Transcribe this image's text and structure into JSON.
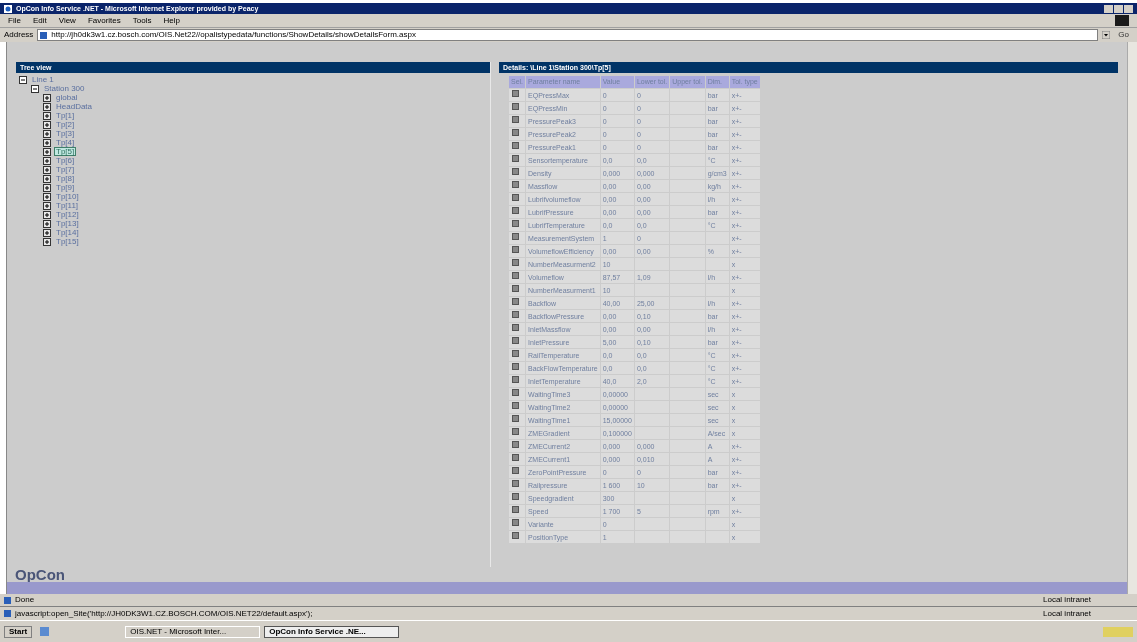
{
  "window": {
    "title": "OpCon Info Service .NET - Microsoft Internet Explorer provided by Peacy"
  },
  "menu": [
    {
      "label": "File"
    },
    {
      "label": "Edit"
    },
    {
      "label": "View"
    },
    {
      "label": "Favorites"
    },
    {
      "label": "Tools"
    },
    {
      "label": "Help"
    }
  ],
  "address_bar": {
    "label": "Address",
    "value": "http://jh0dk3w1.cz.bosch.com/OIS.Net22//opalistypedata/functions/ShowDetails/showDetailsForm.aspx",
    "go": "Go"
  },
  "tree_panel": {
    "title": "Tree view",
    "nodes": [
      {
        "label": "Line 1",
        "expanded": true,
        "selected": false,
        "children": [
          {
            "label": "Station 300",
            "expanded": true,
            "selected": false,
            "children": [
              {
                "label": "global",
                "expanded": false,
                "selected": false
              },
              {
                "label": "HeadData",
                "expanded": false,
                "selected": false
              },
              {
                "label": "Tp[1]",
                "expanded": false,
                "selected": false
              },
              {
                "label": "Tp[2]",
                "expanded": false,
                "selected": false
              },
              {
                "label": "Tp[3]",
                "expanded": false,
                "selected": false
              },
              {
                "label": "Tp[4]",
                "expanded": false,
                "selected": false
              },
              {
                "label": "Tp[5]",
                "expanded": false,
                "selected": true
              },
              {
                "label": "Tp[6]",
                "expanded": false,
                "selected": false
              },
              {
                "label": "Tp[7]",
                "expanded": false,
                "selected": false
              },
              {
                "label": "Tp[8]",
                "expanded": false,
                "selected": false
              },
              {
                "label": "Tp[9]",
                "expanded": false,
                "selected": false
              },
              {
                "label": "Tp[10]",
                "expanded": false,
                "selected": false
              },
              {
                "label": "Tp[11]",
                "expanded": false,
                "selected": false
              },
              {
                "label": "Tp[12]",
                "expanded": false,
                "selected": false
              },
              {
                "label": "Tp[13]",
                "expanded": false,
                "selected": false
              },
              {
                "label": "Tp[14]",
                "expanded": false,
                "selected": false
              },
              {
                "label": "Tp[15]",
                "expanded": false,
                "selected": false
              }
            ]
          }
        ]
      }
    ]
  },
  "details_panel": {
    "title": "Details: \\Line 1\\Station 300\\Tp[5]",
    "table": {
      "columns": [
        "Sel.",
        "Parameter name",
        "Value",
        "Lower tol.",
        "Upper tol.",
        "Dim.",
        "Tol. type"
      ],
      "rows": [
        {
          "checked": true,
          "name": "EQPressMax",
          "value": "0",
          "lower": "0",
          "dim": "bar",
          "tol": "x+-"
        },
        {
          "checked": true,
          "name": "EQPressMin",
          "value": "0",
          "lower": "0",
          "dim": "bar",
          "tol": "x+-"
        },
        {
          "checked": true,
          "name": "PressurePeak3",
          "value": "0",
          "lower": "0",
          "dim": "bar",
          "tol": "x+-"
        },
        {
          "checked": true,
          "name": "PressurePeak2",
          "value": "0",
          "lower": "0",
          "dim": "bar",
          "tol": "x+-"
        },
        {
          "checked": true,
          "name": "PressurePeak1",
          "value": "0",
          "lower": "0",
          "dim": "bar",
          "tol": "x+-"
        },
        {
          "checked": true,
          "name": "Sensortemperature",
          "value": "0,0",
          "lower": "0,0",
          "dim": "°C",
          "tol": "x+-"
        },
        {
          "checked": true,
          "name": "Density",
          "value": "0,000",
          "lower": "0,000",
          "dim": "g/cm3",
          "tol": "x+-"
        },
        {
          "checked": true,
          "name": "Massflow",
          "value": "0,00",
          "lower": "0,00",
          "dim": "kg/h",
          "tol": "x+-"
        },
        {
          "checked": true,
          "name": "Lubrifvolumeflow",
          "value": "0,00",
          "lower": "0,00",
          "dim": "l/h",
          "tol": "x+-"
        },
        {
          "checked": true,
          "name": "LubrifPressure",
          "value": "0,00",
          "lower": "0,00",
          "dim": "bar",
          "tol": "x+-"
        },
        {
          "checked": true,
          "name": "LubrifTemperature",
          "value": "0,0",
          "lower": "0,0",
          "dim": "°C",
          "tol": "x+-"
        },
        {
          "checked": true,
          "name": "MeasurementSystem",
          "value": "1",
          "lower": "0",
          "tol": "x+-"
        },
        {
          "checked": true,
          "name": "VolumeflowEfficiency",
          "value": "0,00",
          "lower": "0,00",
          "dim": "%",
          "tol": "x+-"
        },
        {
          "checked": true,
          "name": "NumberMeasurment2",
          "value": "10",
          "tol": "x"
        },
        {
          "checked": true,
          "name": "Volumeflow",
          "value": "87,57",
          "lower": "1,09",
          "dim": "l/h",
          "tol": "x+-"
        },
        {
          "checked": true,
          "name": "NumberMeasurment1",
          "value": "10",
          "tol": "x"
        },
        {
          "checked": true,
          "name": "Backflow",
          "value": "40,00",
          "lower": "25,00",
          "dim": "l/h",
          "tol": "x+-"
        },
        {
          "checked": true,
          "name": "BackflowPressure",
          "value": "0,00",
          "lower": "0,10",
          "dim": "bar",
          "tol": "x+-"
        },
        {
          "checked": true,
          "name": "InletMassflow",
          "value": "0,00",
          "lower": "0,00",
          "dim": "l/h",
          "tol": "x+-"
        },
        {
          "checked": true,
          "name": "InletPressure",
          "value": "5,00",
          "lower": "0,10",
          "dim": "bar",
          "tol": "x+-"
        },
        {
          "checked": true,
          "name": "RailTemperature",
          "value": "0,0",
          "lower": "0,0",
          "dim": "°C",
          "tol": "x+-"
        },
        {
          "checked": true,
          "name": "BackFlowTemperature",
          "value": "0,0",
          "lower": "0,0",
          "dim": "°C",
          "tol": "x+-"
        },
        {
          "checked": true,
          "name": "InletTemperature",
          "value": "40,0",
          "lower": "2,0",
          "dim": "°C",
          "tol": "x+-"
        },
        {
          "checked": true,
          "name": "WaitingTime3",
          "value": "0,00000",
          "dim": "sec",
          "tol": "x"
        },
        {
          "checked": true,
          "name": "WaitingTime2",
          "value": "0,00000",
          "dim": "sec",
          "tol": "x"
        },
        {
          "checked": true,
          "name": "WaitingTime1",
          "value": "15,00000",
          "dim": "sec",
          "tol": "x"
        },
        {
          "checked": true,
          "name": "ZMEGradient",
          "value": "0,100000",
          "dim": "A/sec",
          "tol": "x"
        },
        {
          "checked": true,
          "name": "ZMECurrent2",
          "value": "0,000",
          "lower": "0,000",
          "dim": "A",
          "tol": "x+-"
        },
        {
          "checked": true,
          "name": "ZMECurrent1",
          "value": "0,000",
          "lower": "0,010",
          "dim": "A",
          "tol": "x+-"
        },
        {
          "checked": true,
          "name": "ZeroPointPressure",
          "value": "0",
          "lower": "0",
          "dim": "bar",
          "tol": "x+-"
        },
        {
          "checked": true,
          "name": "Railpressure",
          "value": "1 600",
          "lower": "10",
          "dim": "bar",
          "tol": "x+-"
        },
        {
          "checked": true,
          "name": "Speedgradient",
          "value": "300",
          "tol": "x"
        },
        {
          "checked": true,
          "name": "Speed",
          "value": "1 700",
          "lower": "5",
          "dim": "rpm",
          "tol": "x+-"
        },
        {
          "checked": true,
          "name": "Variante",
          "value": "0",
          "tol": "x"
        },
        {
          "checked": true,
          "name": "PositionType",
          "value": "1",
          "tol": "x"
        }
      ]
    }
  },
  "footer_logo": "OpCon",
  "status_bar": {
    "text": "Done",
    "zone": "Local intranet"
  },
  "status_bar_2": {
    "text": "javascript:open_Site('http://JH0DK3W1.CZ.BOSCH.COM/OIS.NET22/default.aspx');",
    "zone": "Local intranet"
  },
  "taskbar": {
    "start": "Start",
    "tasks": [
      {
        "label": "OIS.NET - Microsoft Inter...",
        "selected": false
      },
      {
        "label": "OpCon Info Service .NE...",
        "selected": true
      }
    ]
  }
}
